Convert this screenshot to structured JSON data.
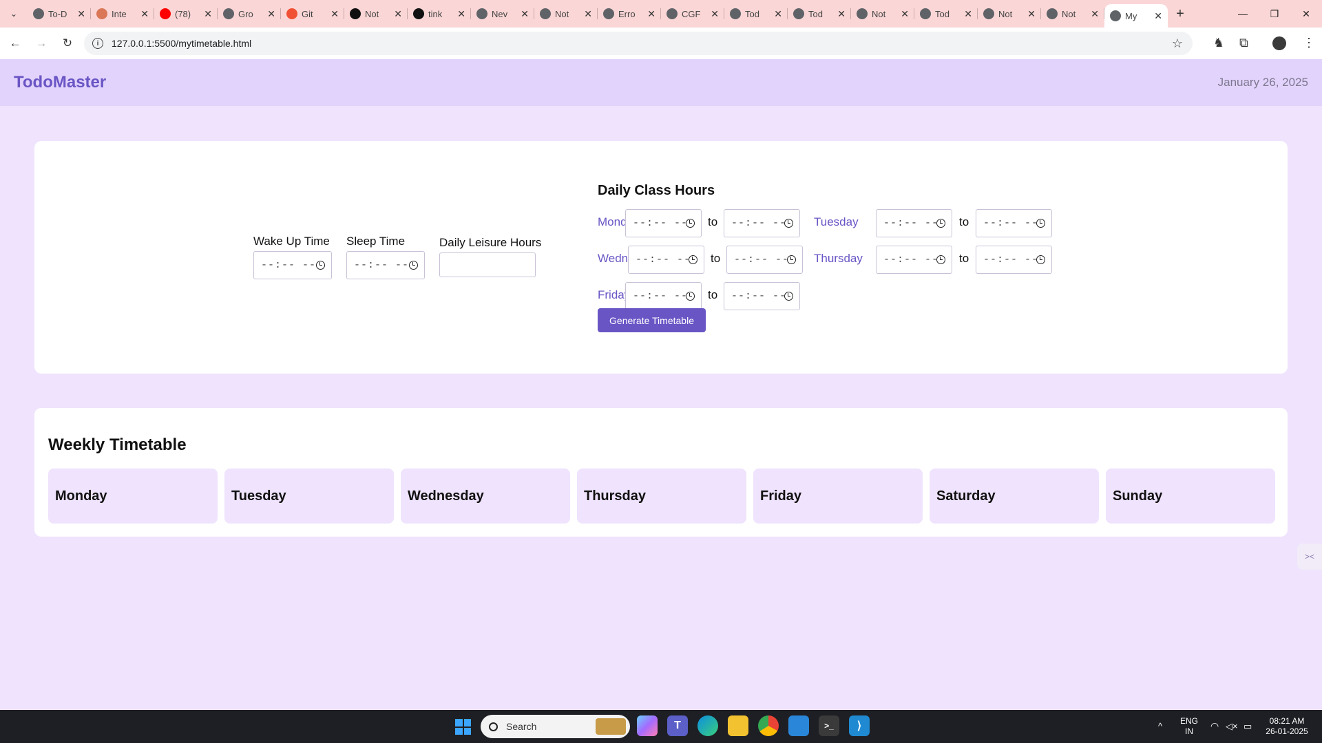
{
  "browser": {
    "tabs": [
      {
        "label": "To-D",
        "icon": "globe-icon",
        "color": "#5f6368"
      },
      {
        "label": "Inte",
        "icon": "claude-icon",
        "color": "#d97757"
      },
      {
        "label": "(78)",
        "icon": "youtube-icon",
        "color": "#ff0000"
      },
      {
        "label": "Gro",
        "icon": "globe-icon",
        "color": "#5f6368"
      },
      {
        "label": "Git",
        "icon": "git-icon",
        "color": "#f05033"
      },
      {
        "label": "Not",
        "icon": "github-icon",
        "color": "#111111"
      },
      {
        "label": "tink",
        "icon": "github-icon",
        "color": "#111111"
      },
      {
        "label": "Nev",
        "icon": "globe-icon",
        "color": "#5f6368"
      },
      {
        "label": "Not",
        "icon": "globe-icon",
        "color": "#5f6368"
      },
      {
        "label": "Erro",
        "icon": "globe-icon",
        "color": "#5f6368"
      },
      {
        "label": "CGF",
        "icon": "globe-icon",
        "color": "#5f6368"
      },
      {
        "label": "Tod",
        "icon": "globe-icon",
        "color": "#5f6368"
      },
      {
        "label": "Tod",
        "icon": "globe-icon",
        "color": "#5f6368"
      },
      {
        "label": "Not",
        "icon": "globe-icon",
        "color": "#5f6368"
      },
      {
        "label": "Tod",
        "icon": "globe-icon",
        "color": "#5f6368"
      },
      {
        "label": "Not",
        "icon": "globe-icon",
        "color": "#5f6368"
      },
      {
        "label": "Not",
        "icon": "globe-icon",
        "color": "#5f6368"
      },
      {
        "label": "My",
        "icon": "globe-icon",
        "color": "#5f6368",
        "active": true
      }
    ],
    "url": "127.0.0.1:5500/mytimetable.html"
  },
  "app": {
    "brand": "TodoMaster",
    "date": "January 26, 2025",
    "accent": "#6a55c5"
  },
  "setup": {
    "wake_label": "Wake Up Time",
    "sleep_label": "Sleep Time",
    "leisure_label": "Daily Leisure Hours",
    "time_placeholder": "--:-- --",
    "leisure_value": "",
    "class_hours_title": "Daily Class Hours",
    "to_label": "to",
    "days": [
      "Monday",
      "Tuesday",
      "Wednesday",
      "Thursday",
      "Friday"
    ],
    "generate_label": "Generate Timetable"
  },
  "timetable": {
    "title": "Weekly Timetable",
    "days": [
      "Monday",
      "Tuesday",
      "Wednesday",
      "Thursday",
      "Friday",
      "Saturday",
      "Sunday"
    ]
  },
  "taskbar": {
    "search_placeholder": "Search",
    "lang_top": "ENG",
    "lang_bottom": "IN",
    "time": "08:21 AM",
    "date": "26-01-2025"
  }
}
